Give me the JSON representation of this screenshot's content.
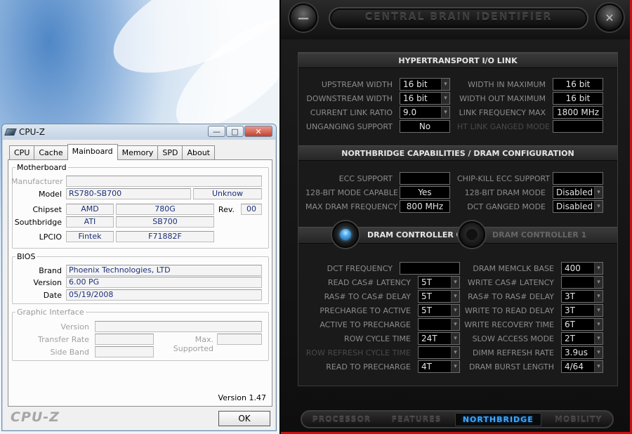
{
  "cpuz": {
    "title": "CPU-Z",
    "buttons": {
      "minimize": "—",
      "maximize": "□",
      "close": "✕"
    },
    "tabs": [
      "CPU",
      "Cache",
      "Mainboard",
      "Memory",
      "SPD",
      "About"
    ],
    "active_tab": "Mainboard",
    "motherboard": {
      "legend": "Motherboard",
      "manufacturer_label": "Manufacturer",
      "manufacturer_value": "",
      "model_label": "Model",
      "model_value": "RS780-SB700",
      "model_rev": "Unknow",
      "chipset_label": "Chipset",
      "chipset_vendor": "AMD",
      "chipset_model": "780G",
      "rev_label": "Rev.",
      "rev_value": "00",
      "southbridge_label": "Southbridge",
      "southbridge_vendor": "ATI",
      "southbridge_model": "SB700",
      "lpcio_label": "LPCIO",
      "lpcio_vendor": "Fintek",
      "lpcio_model": "F71882F"
    },
    "bios": {
      "legend": "BIOS",
      "brand_label": "Brand",
      "brand_value": "Phoenix Technologies, LTD",
      "version_label": "Version",
      "version_value": "6.00 PG",
      "date_label": "Date",
      "date_value": "05/19/2008"
    },
    "graphic": {
      "legend": "Graphic Interface",
      "version_label": "Version",
      "transfer_label": "Transfer Rate",
      "max_label": "Max. Supported",
      "sideband_label": "Side Band"
    },
    "footer_version": "Version 1.47",
    "logo": "CPU-Z",
    "ok_label": "OK"
  },
  "cbi": {
    "title": "CENTRAL BRAIN IDENTIFIER",
    "min_glyph": "—",
    "close_glyph": "✕",
    "ht": {
      "header": "HYPERTRANSPORT I/O LINK",
      "rows": [
        {
          "l1": "UPSTREAM WIDTH",
          "v1": "16 bit",
          "l2": "WIDTH IN MAXIMUM",
          "v2": "16 bit"
        },
        {
          "l1": "DOWNSTREAM WIDTH",
          "v1": "16 bit",
          "l2": "WIDTH OUT MAXIMUM",
          "v2": "16 bit"
        },
        {
          "l1": "CURRENT LINK RATIO",
          "v1": "9.0",
          "l2": "LINK FREQUENCY MAX",
          "v2": "1800 MHz"
        },
        {
          "l1": "UNGANGING SUPPORT",
          "v1": "No",
          "l2": "HT LINK GANGED MODE",
          "v2": ""
        }
      ]
    },
    "nb": {
      "header": "NORTHBRIDGE CAPABILITIES / DRAM CONFIGURATION",
      "rows": [
        {
          "l1": "ECC SUPPORT",
          "v1": "",
          "l2": "CHIP-KILL ECC SUPPORT",
          "v2": ""
        },
        {
          "l1": "128-BIT MODE CAPABLE",
          "v1": "Yes",
          "l2": "128-BIT DRAM MODE",
          "v2": "Disabled"
        },
        {
          "l1": "MAX DRAM FREQUENCY",
          "v1": "800 MHz",
          "l2": "DCT GANGED MODE",
          "v2": "Disabled"
        }
      ]
    },
    "dram": {
      "ctrl0": "DRAM CONTROLLER 0",
      "ctrl1": "DRAM CONTROLLER 1",
      "rows": [
        {
          "l1": "DCT FREQUENCY",
          "v1": "",
          "l2": "DRAM MEMCLK BASE",
          "v2": "400"
        },
        {
          "l1": "READ CAS# LATENCY",
          "v1": "5T",
          "l2": "WRITE CAS# LATENCY",
          "v2": ""
        },
        {
          "l1": "RAS# TO CAS# DELAY",
          "v1": "5T",
          "l2": "RAS# TO RAS# DELAY",
          "v2": "3T"
        },
        {
          "l1": "PRECHARGE TO ACTIVE",
          "v1": "5T",
          "l2": "WRITE TO READ DELAY",
          "v2": "3T"
        },
        {
          "l1": "ACTIVE TO PRECHARGE",
          "v1": "",
          "l2": "WRITE RECOVERY TIME",
          "v2": "6T"
        },
        {
          "l1": "ROW CYCLE TIME",
          "v1": "24T",
          "l2": "SLOW ACCESS MODE",
          "v2": "2T"
        },
        {
          "l1": "ROW REFRESH CYCLE TIME",
          "v1": "",
          "l2": "DIMM REFRESH RATE",
          "v2": "3.9us"
        },
        {
          "l1": "READ TO PRECHARGE",
          "v1": "4T",
          "l2": "DRAM BURST LENGTH",
          "v2": "4/64"
        }
      ]
    },
    "nav": [
      "PROCESSOR",
      "FEATURES",
      "NORTHBRIDGE",
      "MOBILITY"
    ],
    "nav_active": "NORTHBRIDGE",
    "accent": "#3ea7ff"
  }
}
